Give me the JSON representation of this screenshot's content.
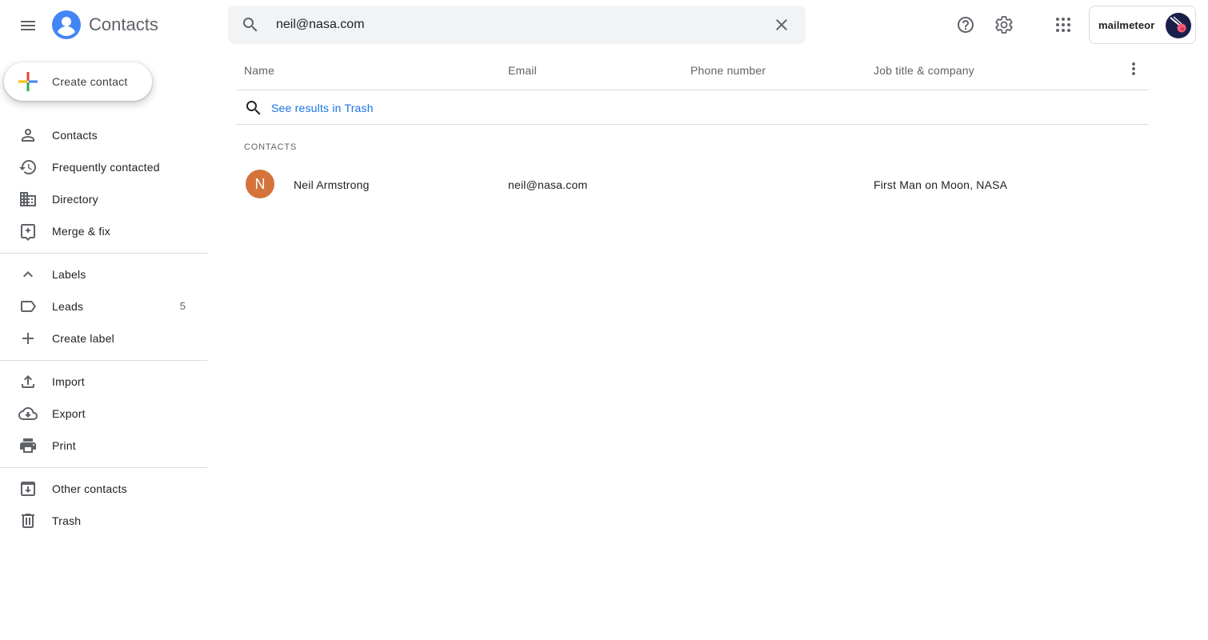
{
  "app": {
    "title": "Contacts",
    "logo_color": "#4285f4"
  },
  "search": {
    "value": "neil@nasa.com",
    "placeholder": "Search"
  },
  "header_icons": [
    "help-icon",
    "settings-icon",
    "apps-grid-icon"
  ],
  "account": {
    "name": "mailmeteor"
  },
  "sidebar": {
    "create_label": "Create contact",
    "items": [
      {
        "label": "Contacts",
        "icon": "person-icon"
      },
      {
        "label": "Frequently contacted",
        "icon": "history-icon"
      },
      {
        "label": "Directory",
        "icon": "building-icon"
      },
      {
        "label": "Merge & fix",
        "icon": "merge-fix-icon"
      }
    ],
    "labels_section": {
      "header": "Labels",
      "items": [
        {
          "label": "Leads",
          "count": "5",
          "icon": "label-icon"
        }
      ],
      "create_label": "Create label"
    },
    "tools": [
      {
        "label": "Import",
        "icon": "upload-icon"
      },
      {
        "label": "Export",
        "icon": "cloud-download-icon"
      },
      {
        "label": "Print",
        "icon": "print-icon"
      }
    ],
    "other": [
      {
        "label": "Other contacts",
        "icon": "archive-icon"
      },
      {
        "label": "Trash",
        "icon": "trash-icon"
      }
    ]
  },
  "table": {
    "columns": [
      "Name",
      "Email",
      "Phone number",
      "Job title & company"
    ],
    "trash_link": "See results in Trash",
    "section_label": "CONTACTS",
    "rows": [
      {
        "initial": "N",
        "avatar_color": "#d4733a",
        "name": "Neil Armstrong",
        "email": "neil@nasa.com",
        "phone": "",
        "job": "First Man on Moon, NASA"
      }
    ]
  }
}
